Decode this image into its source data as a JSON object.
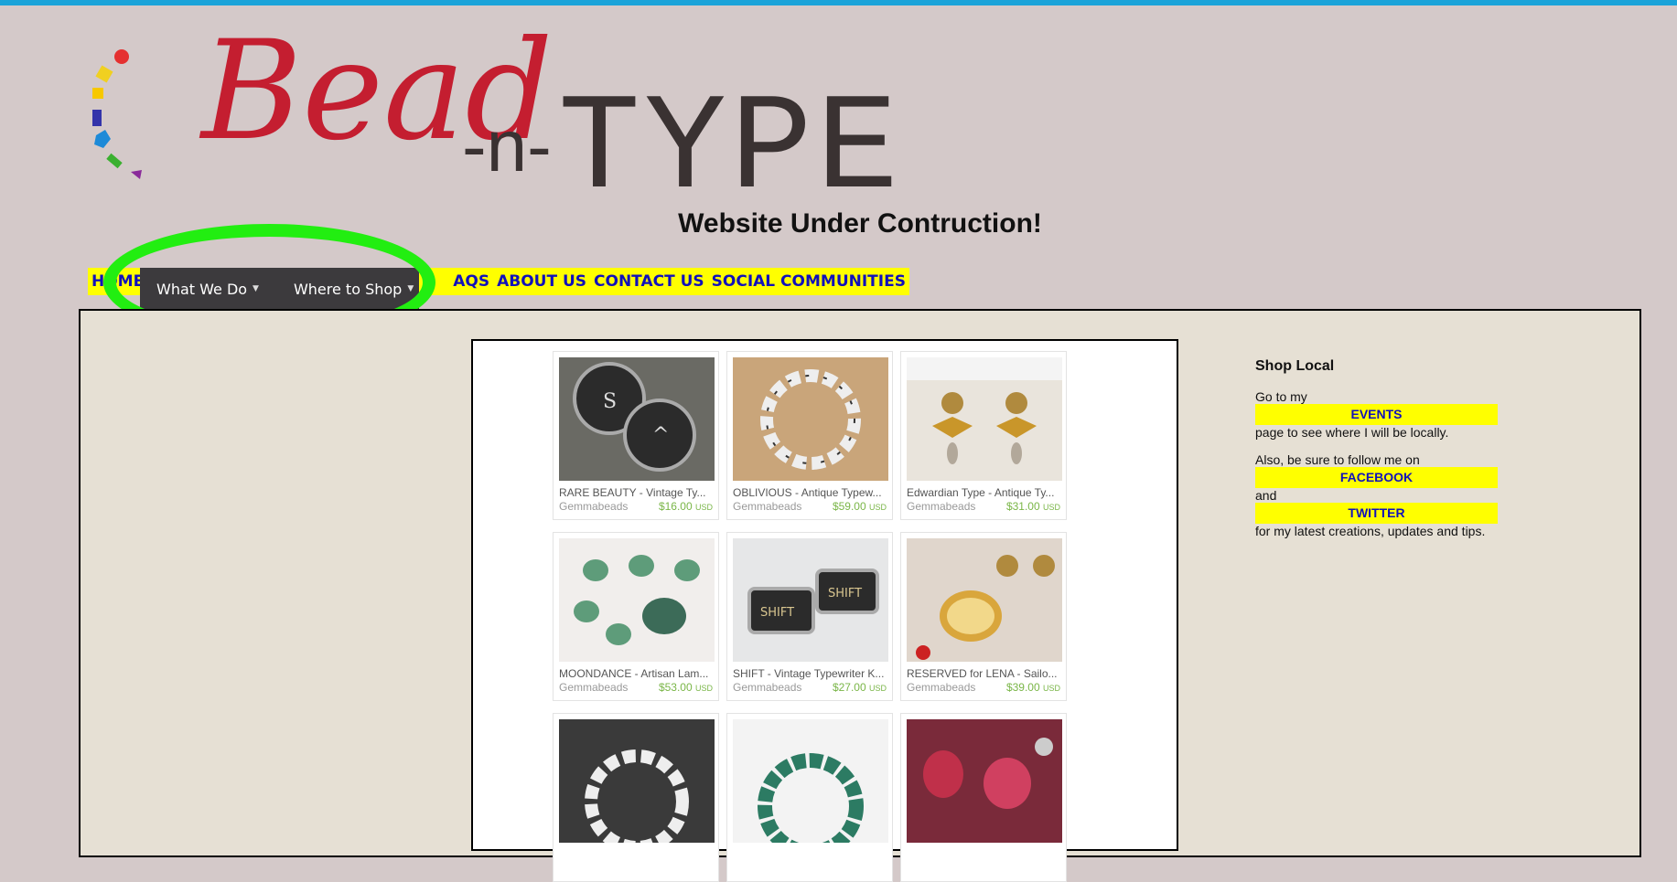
{
  "logo": {
    "word1": "Bead",
    "joiner": "-n-",
    "word2": "TYPE"
  },
  "headline": "Website Under Contruction!",
  "nav": {
    "left_partial": "HOME",
    "items": [
      "AQS",
      "ABOUT US",
      "CONTACT US",
      "SOCIAL COMMUNITIES"
    ],
    "dropdowns": [
      "What We Do",
      "Where to Shop"
    ]
  },
  "listings": [
    {
      "title": "RARE BEAUTY - Vintage Ty...",
      "shop": "Gemmabeads",
      "price": "$16.00",
      "currency": "USD"
    },
    {
      "title": "OBLIVIOUS - Antique Typew...",
      "shop": "Gemmabeads",
      "price": "$59.00",
      "currency": "USD"
    },
    {
      "title": "Edwardian Type - Antique Ty...",
      "shop": "Gemmabeads",
      "price": "$31.00",
      "currency": "USD"
    },
    {
      "title": "MOONDANCE - Artisan Lam...",
      "shop": "Gemmabeads",
      "price": "$53.00",
      "currency": "USD"
    },
    {
      "title": "SHIFT - Vintage Typewriter K...",
      "shop": "Gemmabeads",
      "price": "$27.00",
      "currency": "USD"
    },
    {
      "title": "RESERVED for LENA - Sailo...",
      "shop": "Gemmabeads",
      "price": "$39.00",
      "currency": "USD"
    }
  ],
  "sidebar": {
    "heading": "Shop Local",
    "line1": "Go to my",
    "events": "EVENTS",
    "line2": "page to see where I will be locally.",
    "line3": "Also, be sure to follow me on",
    "facebook": "FACEBOOK",
    "and": "and",
    "twitter": "TWITTER",
    "line4": "for my latest creations, updates and tips."
  },
  "colors": {
    "accent_bar": "#1aa3d9",
    "nav_bg": "#ffff00",
    "nav_link": "#1111bb",
    "highlight": "#22ee11",
    "price": "#7ab648"
  }
}
